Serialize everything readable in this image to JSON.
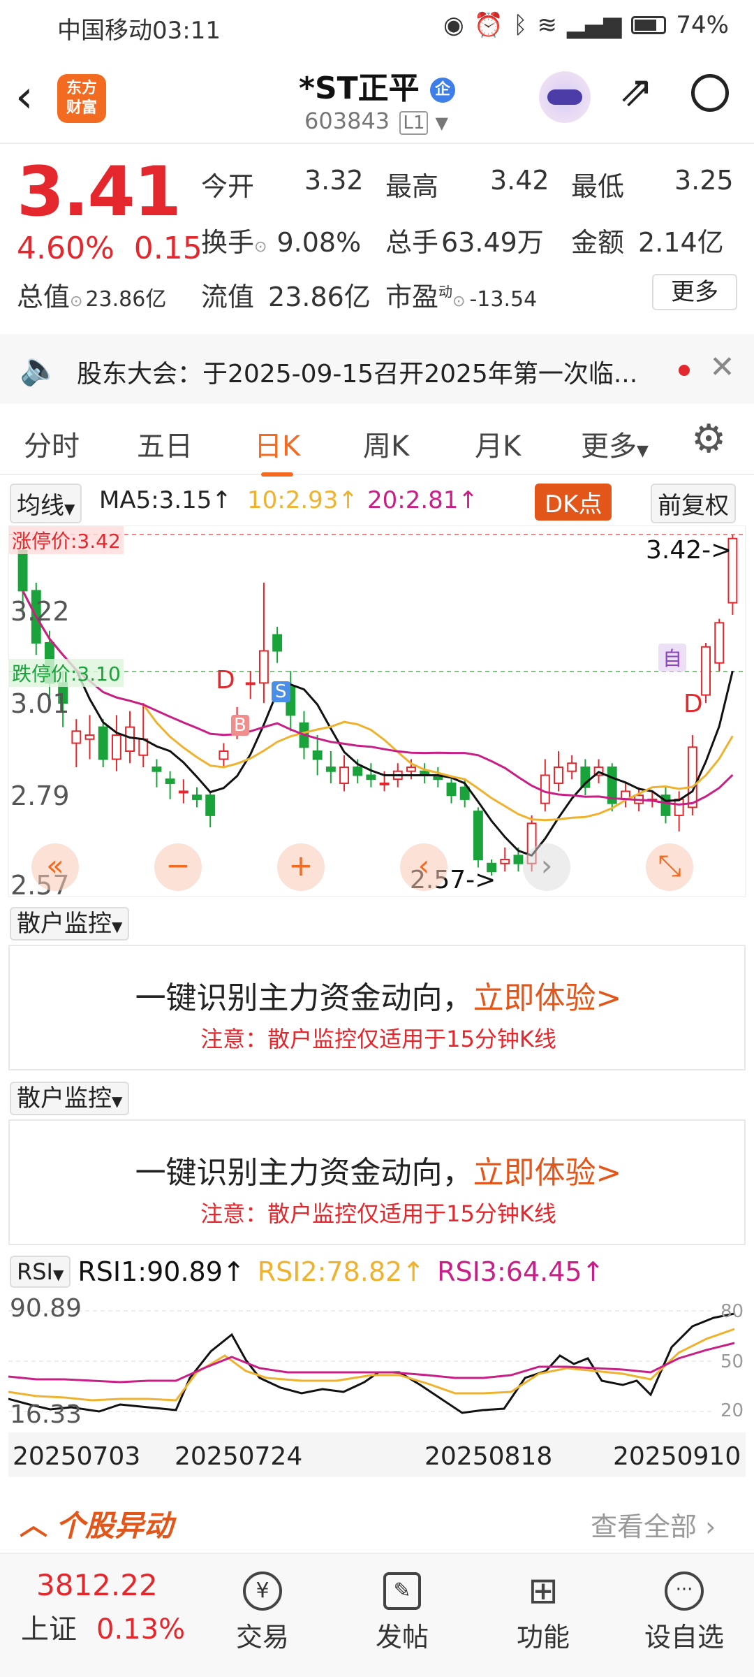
{
  "status_bar": {
    "carrier": "中国移动",
    "time": "03:11",
    "battery": "74%"
  },
  "header": {
    "logo_text": "东方\n财富",
    "title": "*ST正平",
    "code": "603843",
    "level": "L1"
  },
  "quote": {
    "price": "3.41",
    "change_pct": "4.60%",
    "change_abs": "0.15",
    "open_label": "今开",
    "open": "3.32",
    "high_label": "最高",
    "high": "3.42",
    "low_label": "最低",
    "low": "3.25",
    "turnover_label": "换手",
    "turnover": "9.08%",
    "volume_label": "总手",
    "volume": "63.49万",
    "amount_label": "金额",
    "amount": "2.14亿",
    "mktcap_label": "总值",
    "mktcap": "23.86亿",
    "float_label": "流值",
    "float": "23.86亿",
    "pe_label": "市盈",
    "pe_sup": "动",
    "pe": "-13.54",
    "more_label": "更多"
  },
  "notice": {
    "text": "股东大会：于2025-09-15召开2025年第一次临..."
  },
  "tabs": [
    "分时",
    "五日",
    "日K",
    "周K",
    "月K",
    "更多"
  ],
  "active_tab": "日K",
  "ma_row": {
    "selector": "均线",
    "ma5": "MA5:3.15↑",
    "ma10": "10:2.93↑",
    "ma20": "20:2.81↑",
    "dk": "DK点",
    "adjust": "前复权"
  },
  "kline_labels": {
    "limit_up": "涨停价:3.42",
    "limit_down": "跌停价:3.10",
    "y_ticks": [
      "3.22",
      "3.01",
      "2.79",
      "2.57"
    ],
    "high_tag": "3.42->",
    "low_tag": "2.57->",
    "mark_d": "D",
    "mark_b": "B",
    "mark_s": "S",
    "mark_zi": "自"
  },
  "chart_data": {
    "type": "candlestick",
    "ylim": [
      2.57,
      3.42
    ],
    "candles": [
      [
        3.38,
        3.28,
        3.42,
        3.22
      ],
      [
        3.28,
        3.15,
        3.3,
        3.12
      ],
      [
        3.15,
        3.05,
        3.18,
        3.0
      ],
      [
        3.05,
        3.0,
        3.08,
        2.94
      ],
      [
        2.9,
        2.93,
        2.96,
        2.84
      ],
      [
        2.91,
        2.92,
        2.97,
        2.86
      ],
      [
        2.94,
        2.86,
        2.96,
        2.84
      ],
      [
        2.86,
        2.92,
        2.97,
        2.83
      ],
      [
        2.88,
        2.94,
        2.98,
        2.85
      ],
      [
        2.87,
        2.91,
        3.0,
        2.84
      ],
      [
        2.84,
        2.83,
        2.86,
        2.79
      ],
      [
        2.81,
        2.8,
        2.83,
        2.76
      ],
      [
        2.78,
        2.78,
        2.81,
        2.75
      ],
      [
        2.77,
        2.76,
        2.79,
        2.74
      ],
      [
        2.77,
        2.72,
        2.78,
        2.69
      ],
      [
        2.86,
        2.88,
        2.9,
        2.84
      ],
      [
        2.93,
        2.95,
        2.99,
        2.91
      ],
      [
        3.05,
        3.05,
        3.08,
        3.01
      ],
      [
        3.05,
        3.13,
        3.3,
        3.0
      ],
      [
        3.17,
        3.13,
        3.19,
        3.1
      ],
      [
        3.04,
        2.97,
        3.08,
        2.93
      ],
      [
        2.95,
        2.89,
        2.98,
        2.86
      ],
      [
        2.88,
        2.86,
        2.92,
        2.82
      ],
      [
        2.84,
        2.83,
        2.88,
        2.8
      ],
      [
        2.8,
        2.84,
        2.87,
        2.78
      ],
      [
        2.84,
        2.82,
        2.86,
        2.8
      ],
      [
        2.82,
        2.81,
        2.85,
        2.79
      ],
      [
        2.8,
        2.8,
        2.83,
        2.78
      ],
      [
        2.81,
        2.83,
        2.85,
        2.79
      ],
      [
        2.83,
        2.84,
        2.86,
        2.81
      ],
      [
        2.83,
        2.82,
        2.85,
        2.8
      ],
      [
        2.82,
        2.81,
        2.84,
        2.79
      ],
      [
        2.8,
        2.77,
        2.82,
        2.75
      ],
      [
        2.79,
        2.76,
        2.81,
        2.74
      ],
      [
        2.73,
        2.61,
        2.74,
        2.59
      ],
      [
        2.6,
        2.58,
        2.61,
        2.57
      ],
      [
        2.6,
        2.61,
        2.64,
        2.58
      ],
      [
        2.62,
        2.6,
        2.64,
        2.58
      ],
      [
        2.6,
        2.7,
        2.72,
        2.58
      ],
      [
        2.75,
        2.82,
        2.86,
        2.73
      ],
      [
        2.8,
        2.84,
        2.88,
        2.78
      ],
      [
        2.83,
        2.85,
        2.87,
        2.81
      ],
      [
        2.84,
        2.79,
        2.86,
        2.77
      ],
      [
        2.82,
        2.84,
        2.86,
        2.8
      ],
      [
        2.84,
        2.75,
        2.85,
        2.73
      ],
      [
        2.76,
        2.78,
        2.8,
        2.74
      ],
      [
        2.75,
        2.77,
        2.79,
        2.73
      ],
      [
        2.76,
        2.76,
        2.78,
        2.74
      ],
      [
        2.77,
        2.72,
        2.79,
        2.7
      ],
      [
        2.72,
        2.76,
        2.78,
        2.68
      ],
      [
        2.74,
        2.89,
        2.92,
        2.72
      ],
      [
        3.02,
        3.14,
        3.15,
        3.0
      ],
      [
        3.1,
        3.2,
        3.21,
        3.08
      ],
      [
        3.25,
        3.41,
        3.42,
        3.22
      ]
    ]
  },
  "monitor": {
    "selector": "散户监控",
    "line1": "一键识别主力资金动向，",
    "cta": "立即体验>",
    "line2": "注意：散户监控仅适用于15分钟K线"
  },
  "rsi": {
    "selector": "RSI",
    "rsi1": "RSI1:90.89↑",
    "rsi2": "RSI2:78.82↑",
    "rsi3": "RSI3:64.45↑",
    "top": "90.89",
    "bottom": "16.33",
    "levels": [
      "80",
      "50",
      "20"
    ]
  },
  "dates": [
    "20250703",
    "20250724",
    "20250818",
    "20250910"
  ],
  "movement": {
    "title": "个股异动",
    "link": "查看全部"
  },
  "bottom_nav": {
    "index_value": "3812.22",
    "index_name": "上证",
    "index_change": "0.13%",
    "items": [
      "交易",
      "发帖",
      "功能",
      "设自选"
    ]
  }
}
